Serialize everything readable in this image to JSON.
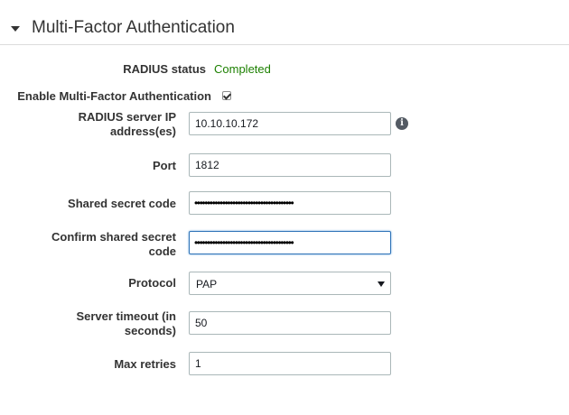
{
  "section": {
    "title": "Multi-Factor Authentication",
    "expand_icon": "caret-down-icon"
  },
  "radius_status": {
    "label": "RADIUS status",
    "value": "Completed",
    "color": "#1d8102"
  },
  "enable_mfa": {
    "label": "Enable Multi-Factor Authentication",
    "checked": true
  },
  "server_ip": {
    "label": "RADIUS server IP address(es)",
    "value": "10.10.10.172",
    "help_icon": "info-icon"
  },
  "port": {
    "label": "Port",
    "value": "1812"
  },
  "shared_secret": {
    "label": "Shared secret code",
    "value": "•••••••••••••••••••••••••••••••••••••••"
  },
  "confirm_secret": {
    "label": "Confirm shared secret code",
    "value": "•••••••••••••••••••••••••••••••••••••••"
  },
  "protocol": {
    "label": "Protocol",
    "selected": "PAP"
  },
  "timeout": {
    "label": "Server timeout (in seconds)",
    "value": "50"
  },
  "max_retries": {
    "label": "Max retries",
    "value": "1"
  }
}
